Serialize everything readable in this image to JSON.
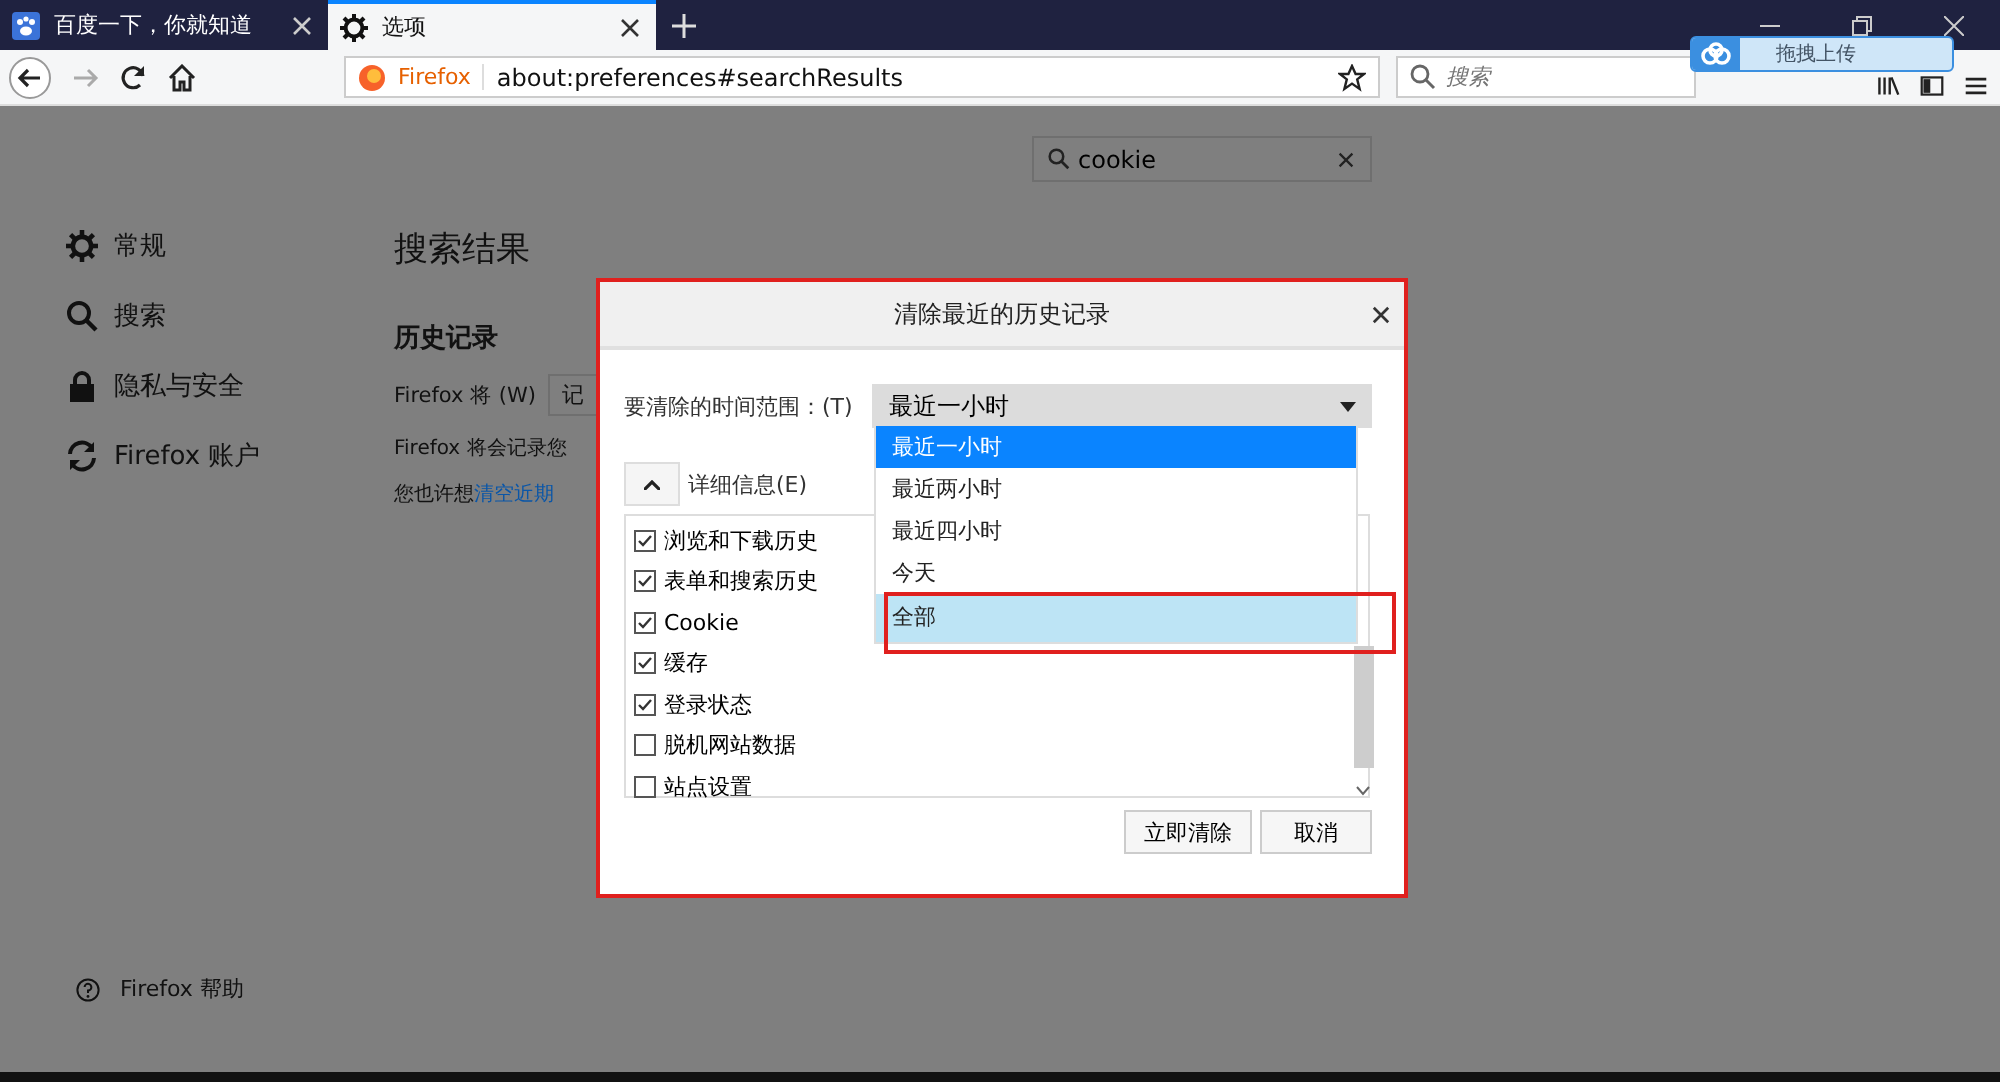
{
  "tabs": [
    {
      "title": "百度一下，你就知道",
      "selected": false
    },
    {
      "title": "选项",
      "selected": true
    }
  ],
  "toolbar": {
    "identity": "Firefox",
    "url": "about:preferences#searchResults",
    "search_placeholder": "搜索",
    "upload_badge": "拖拽上传"
  },
  "preferences": {
    "search_value": "cookie",
    "sidebar": [
      {
        "label": "常规"
      },
      {
        "label": "搜索"
      },
      {
        "label": "隐私与安全"
      },
      {
        "label": "Firefox 账户"
      }
    ],
    "help": "Firefox 帮助",
    "heading": "搜索结果",
    "section": "历史记录",
    "history_label": "Firefox 将 (W)",
    "history_select": "记",
    "history_note": "Firefox 将会记录您",
    "suggestion": "您也许想",
    "suggestion_link": "清空近期"
  },
  "dialog": {
    "title": "清除最近的历史记录",
    "range_label": "要清除的时间范围：(T)",
    "range_value": "最近一小时",
    "options": [
      {
        "label": "最近一小时",
        "selected": true,
        "highlighted": false
      },
      {
        "label": "最近两小时",
        "selected": false,
        "highlighted": false
      },
      {
        "label": "最近四小时",
        "selected": false,
        "highlighted": false
      },
      {
        "label": "今天",
        "selected": false,
        "highlighted": false
      },
      {
        "label": "全部",
        "selected": false,
        "highlighted": true
      }
    ],
    "details_label": "详细信息(E)",
    "details_expanded": true,
    "items": [
      {
        "label": "浏览和下载历史",
        "checked": true
      },
      {
        "label": "表单和搜索历史",
        "checked": true
      },
      {
        "label": "Cookie",
        "checked": true
      },
      {
        "label": "缓存",
        "checked": true
      },
      {
        "label": "登录状态",
        "checked": true
      },
      {
        "label": "脱机网站数据",
        "checked": false
      },
      {
        "label": "站点设置",
        "checked": false
      }
    ],
    "buttons": [
      "立即清除",
      "取消"
    ]
  }
}
